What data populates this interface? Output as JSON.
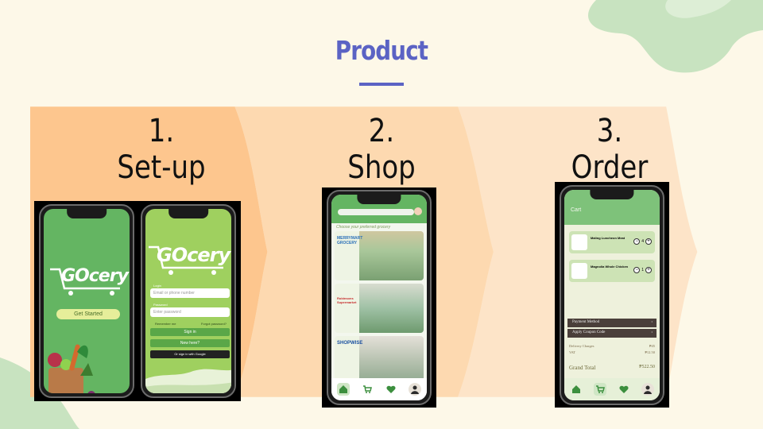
{
  "slide": {
    "title": "Product",
    "colors": {
      "title": "#5b63c4",
      "step1_bg": "#fdc68e",
      "step2_bg": "#fdd9b0",
      "step3_bg": "#fde4c8",
      "app_green": "#64b562",
      "blob_green": "#c8e3c0"
    }
  },
  "steps": [
    {
      "number": "1.",
      "label": "Set-up"
    },
    {
      "number": "2.",
      "label": "Shop"
    },
    {
      "number": "3.",
      "label": "Order"
    }
  ],
  "setup_splash": {
    "logo": "GOcery",
    "cta": "Get Started"
  },
  "setup_login": {
    "logo": "GOcery",
    "login_label": "Login",
    "email_placeholder": "Email or phone number",
    "password_label": "Password",
    "password_placeholder": "Enter password",
    "remember": "Remember me",
    "forgot": "Forgot password?",
    "sign_in": "Sign in",
    "new_here": "New here?",
    "google": "Or sign in with Google"
  },
  "shop": {
    "prompt": "Choose your preferred grocery",
    "stores": [
      {
        "name": "MERRYMART GROCERY"
      },
      {
        "name": "Robinsons Supermarket"
      },
      {
        "name": "SHOPWISE"
      }
    ],
    "nav_icons": [
      "home-icon",
      "cart-icon",
      "heart-icon",
      "profile-icon"
    ]
  },
  "order": {
    "header": "Cart",
    "items": [
      {
        "name": "Maling Luncheon Meat",
        "qty": "4"
      },
      {
        "name": "Magnolia Whole Chicken",
        "qty": "1"
      }
    ],
    "payment": "Payment Method",
    "coupon": "Apply Coupon Code",
    "delivery_label": "Delivery Charges",
    "delivery_value": "₱45",
    "vat_label": "VAT",
    "vat_value": "₱12.50",
    "total_label": "Grand Total",
    "total_value": "₱522.50"
  }
}
